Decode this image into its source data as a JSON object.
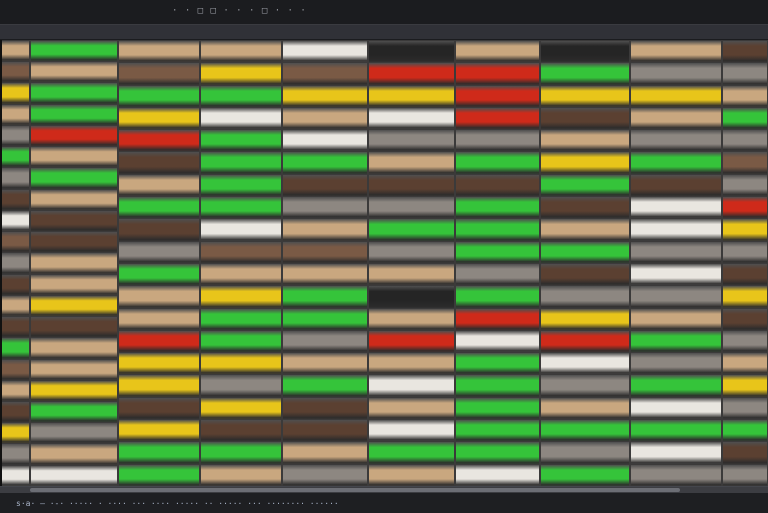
{
  "window": {
    "title": "·  ·  □  □ · · ·  □ · · ·"
  },
  "status": {
    "text": "s·a· — ·-· ····· · ···· ··· ···· ····· ·· ····· ··· ········ ······"
  },
  "colors": {
    "bread": "#c9a77f",
    "dark_bread": "#7a5a45",
    "green": "#35c43a",
    "bright_green": "#4bd546",
    "yellow": "#e8c51a",
    "red": "#cf2a1a",
    "white": "#e9e6e0",
    "brown": "#5b4031",
    "grey": "#8d8781",
    "dark": "#252525"
  },
  "columns": [
    [
      "bread",
      "dark_bread",
      "yellow",
      "bread",
      "grey",
      "green",
      "grey",
      "brown",
      "white",
      "dark_bread",
      "grey",
      "brown",
      "bread",
      "brown",
      "green",
      "dark_bread",
      "bread",
      "brown",
      "yellow",
      "grey",
      "white"
    ],
    [
      "green",
      "bread",
      "green",
      "green",
      "red",
      "bread",
      "green",
      "bread",
      "brown",
      "brown",
      "bread",
      "bread",
      "yellow",
      "brown",
      "bread",
      "bread",
      "yellow",
      "green",
      "grey",
      "bread",
      "white"
    ],
    [
      "bread",
      "dark_bread",
      "green",
      "yellow",
      "red",
      "brown",
      "bread",
      "green",
      "brown",
      "grey",
      "green",
      "bread",
      "bread",
      "red",
      "yellow",
      "yellow",
      "brown",
      "yellow",
      "green",
      "green"
    ],
    [
      "bread",
      "yellow",
      "green",
      "white",
      "green",
      "green",
      "green",
      "green",
      "white",
      "dark_bread",
      "bread",
      "yellow",
      "green",
      "green",
      "yellow",
      "grey",
      "yellow",
      "brown",
      "green",
      "bread"
    ],
    [
      "white",
      "dark_bread",
      "yellow",
      "bread",
      "white",
      "green",
      "brown",
      "grey",
      "bread",
      "dark_bread",
      "bread",
      "green",
      "green",
      "grey",
      "bread",
      "green",
      "brown",
      "brown",
      "bread",
      "grey"
    ],
    [
      "dark",
      "red",
      "yellow",
      "white",
      "grey",
      "bread",
      "brown",
      "grey",
      "green",
      "grey",
      "bread",
      "dark",
      "bread",
      "red",
      "bread",
      "white",
      "bread",
      "white",
      "green",
      "bread"
    ],
    [
      "bread",
      "red",
      "red",
      "red",
      "grey",
      "green",
      "brown",
      "green",
      "green",
      "green",
      "grey",
      "green",
      "red",
      "white",
      "green",
      "green",
      "green",
      "green",
      "green",
      "white"
    ],
    [
      "dark",
      "green",
      "yellow",
      "brown",
      "bread",
      "yellow",
      "green",
      "brown",
      "bread",
      "green",
      "brown",
      "grey",
      "yellow",
      "red",
      "white",
      "grey",
      "bread",
      "green",
      "grey",
      "green"
    ],
    [
      "bread",
      "grey",
      "yellow",
      "bread",
      "grey",
      "green",
      "brown",
      "white",
      "white",
      "grey",
      "white",
      "grey",
      "bread",
      "green",
      "grey",
      "green",
      "white",
      "green",
      "white",
      "grey"
    ],
    [
      "brown",
      "grey",
      "bread",
      "green",
      "grey",
      "dark_bread",
      "grey",
      "red",
      "yellow",
      "grey",
      "brown",
      "yellow",
      "brown",
      "grey",
      "bread",
      "yellow",
      "grey",
      "green",
      "brown",
      "grey"
    ]
  ]
}
